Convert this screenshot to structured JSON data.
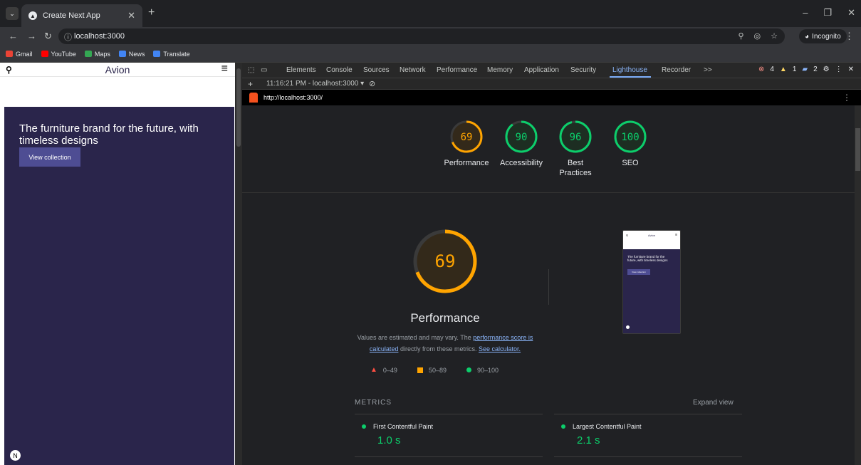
{
  "browser": {
    "tab_title": "Create Next App",
    "url": "localhost:3000",
    "incognito_label": "Incognito",
    "bookmarks": [
      {
        "label": "Gmail",
        "color": "#ea4335"
      },
      {
        "label": "YouTube",
        "color": "#ff0000"
      },
      {
        "label": "Maps",
        "color": "#34a853"
      },
      {
        "label": "News",
        "color": "#4285f4"
      },
      {
        "label": "Translate",
        "color": "#4285f4"
      }
    ]
  },
  "site": {
    "brand": "Avion",
    "hero_title": "The furniture brand for the future, with timeless designs",
    "hero_button": "View collection"
  },
  "devtools": {
    "tabs": [
      "Elements",
      "Console",
      "Sources",
      "Network",
      "Performance",
      "Memory",
      "Application",
      "Security",
      "Lighthouse",
      "Recorder",
      ">>"
    ],
    "active_tab": "Lighthouse",
    "errors": "4",
    "warnings": "1",
    "issues": "2",
    "report_select": "11:16:21 PM - localhost:3000 ▾",
    "report_url": "http://localhost:3000/"
  },
  "lighthouse": {
    "scores": [
      {
        "label": "Performance",
        "value": 69,
        "color": "#ffa400"
      },
      {
        "label": "Accessibility",
        "value": 90,
        "color": "#0cce6b"
      },
      {
        "label": "Best Practices",
        "value": 96,
        "color": "#0cce6b"
      },
      {
        "label": "SEO",
        "value": 100,
        "color": "#0cce6b"
      }
    ],
    "main": {
      "value": 69,
      "title": "Performance",
      "color": "#ffa400"
    },
    "note_prefix": "Values are estimated and may vary. The",
    "note_link1": "performance score is calculated",
    "note_middle": "directly from these metrics.",
    "note_link2": "See calculator.",
    "legend": [
      "0–49",
      "50–89",
      "90–100"
    ],
    "metrics_title": "METRICS",
    "expand_label": "Expand view",
    "metrics": [
      {
        "name": "First Contentful Paint",
        "value": "1.0 s"
      },
      {
        "name": "Largest Contentful Paint",
        "value": "2.1 s"
      }
    ],
    "thumb_brand": "Avion",
    "thumb_hero": "The furniture brand for the future, with timeless designs",
    "thumb_button": "View collection"
  }
}
